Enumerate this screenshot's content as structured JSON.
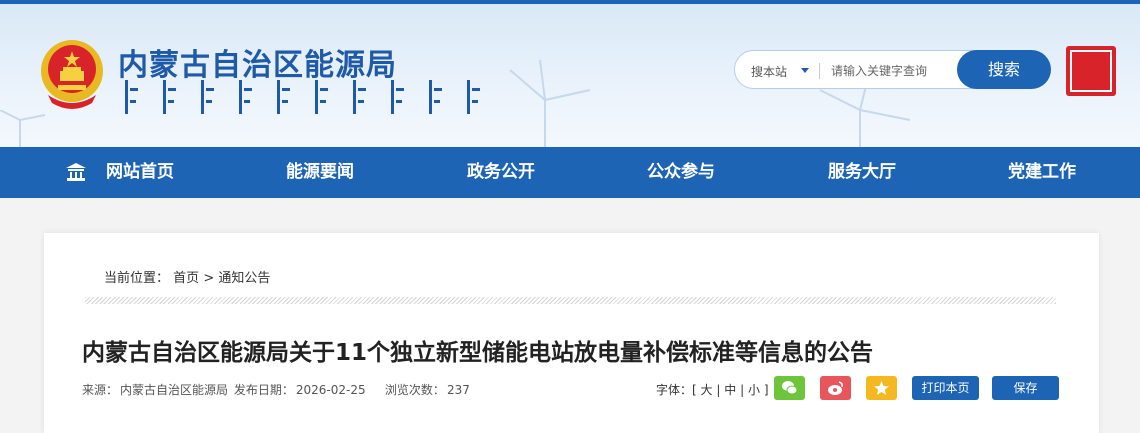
{
  "header": {
    "site_title": "内蒙古自治区能源局",
    "search": {
      "scope_label": "搜本站",
      "placeholder": "请输入关键字查询",
      "button_label": "搜索"
    }
  },
  "nav": {
    "items": [
      {
        "label": "网站首页",
        "icon": "home-icon"
      },
      {
        "label": "能源要闻"
      },
      {
        "label": "政务公开"
      },
      {
        "label": "公众参与"
      },
      {
        "label": "服务大厅"
      },
      {
        "label": "党建工作"
      }
    ]
  },
  "breadcrumb": {
    "prefix": "当前位置：",
    "home": "首页",
    "separator": ">",
    "current": "通知公告"
  },
  "article": {
    "title": "内蒙古自治区能源局关于11个独立新型储能电站放电量补偿标准等信息的公告",
    "source_label": "来源：",
    "source": "内蒙古自治区能源局",
    "date_label": "发布日期：",
    "date": "2026-02-25",
    "views_label": "浏览次数：",
    "views": "237"
  },
  "toolbar": {
    "font_label": "字体：",
    "font_open": "[",
    "font_large": "大",
    "font_sep": "|",
    "font_medium": "中",
    "font_small": "小",
    "font_close": "]",
    "print_label": "打印本页",
    "save_label": "保存"
  },
  "colors": {
    "primary": "#1e64b4",
    "wechat": "#6ec43b",
    "weibo": "#e8555b",
    "favorite": "#f5b820",
    "seal": "#d9232a"
  }
}
